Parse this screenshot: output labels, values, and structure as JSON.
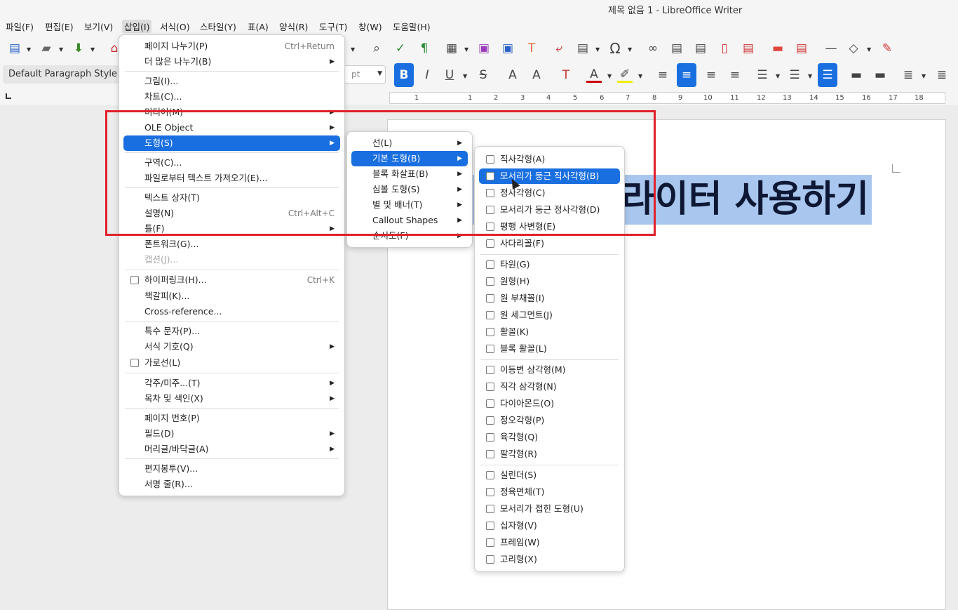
{
  "window": {
    "title": "제목 없음 1 - LibreOffice Writer"
  },
  "menubar": [
    "파일(F)",
    "편집(E)",
    "보기(V)",
    "삽입(I)",
    "서식(O)",
    "스타일(Y)",
    "표(A)",
    "양식(R)",
    "도구(T)",
    "창(W)",
    "도움말(H)"
  ],
  "formatting": {
    "paragraph_style": "Default Paragraph Style",
    "font_size": "pt"
  },
  "ruler": [
    "1",
    "1",
    "2",
    "3",
    "4",
    "5",
    "6",
    "7",
    "8",
    "9",
    "10",
    "11",
    "12",
    "13",
    "14",
    "15",
    "16",
    "17",
    "18"
  ],
  "document": {
    "heading_visible": "리브레 라이터 사용하기"
  },
  "insert_menu": {
    "items": [
      {
        "label": "페이지 나누기(P)",
        "accel": "Ctrl+Return"
      },
      {
        "label": "더 많은 나누기(B)"
      },
      {
        "label": "그림(I)..."
      },
      {
        "label": "차트(C)..."
      },
      {
        "label": "미디어(M)"
      },
      {
        "label": "OLE Object"
      },
      {
        "label": "도형(S)"
      },
      {
        "label": "구역(C)..."
      },
      {
        "label": "파일로부터 텍스트 가져오기(E)..."
      },
      {
        "label": "텍스트 상자(T)"
      },
      {
        "label": "설명(N)",
        "accel": "Ctrl+Alt+C"
      },
      {
        "label": "틀(F)"
      },
      {
        "label": "폰트워크(G)..."
      },
      {
        "label": "캡션(J)..."
      },
      {
        "label": "하이퍼링크(H)...",
        "accel": "Ctrl+K"
      },
      {
        "label": "책갈피(K)..."
      },
      {
        "label": "Cross-reference..."
      },
      {
        "label": "특수 문자(P)..."
      },
      {
        "label": "서식 기호(Q)"
      },
      {
        "label": "가로선(L)"
      },
      {
        "label": "각주/미주...(T)"
      },
      {
        "label": "목차 및 색인(X)"
      },
      {
        "label": "페이지 번호(P)"
      },
      {
        "label": "필드(D)"
      },
      {
        "label": "머리글/바닥글(A)"
      },
      {
        "label": "편지봉투(V)..."
      },
      {
        "label": "서명 줄(R)..."
      }
    ]
  },
  "shape_submenu": {
    "items": [
      "선(L)",
      "기본 도형(B)",
      "블록 화살표(B)",
      "심볼 도형(S)",
      "별 및 배너(T)",
      "Callout Shapes",
      "순서도(F)"
    ]
  },
  "basic_shapes_submenu": {
    "items": [
      "직사각형(A)",
      "모서리가 둥근 직사각형(B)",
      "정사각형(C)",
      "모서리가 둥근 정사각형(D)",
      "평행 사변형(E)",
      "사다리꼴(F)",
      "타원(G)",
      "원형(H)",
      "원 부채꼴(I)",
      "원 세그먼트(J)",
      "활꼴(K)",
      "블록 활꼴(L)",
      "이등변 삼각형(M)",
      "직각 삼각형(N)",
      "다이아몬드(O)",
      "정오각형(P)",
      "육각형(Q)",
      "팔각형(R)",
      "실린더(S)",
      "정육면체(T)",
      "모서리가 접힌 도형(U)",
      "십자형(V)",
      "프레임(W)",
      "고리형(X)"
    ]
  }
}
